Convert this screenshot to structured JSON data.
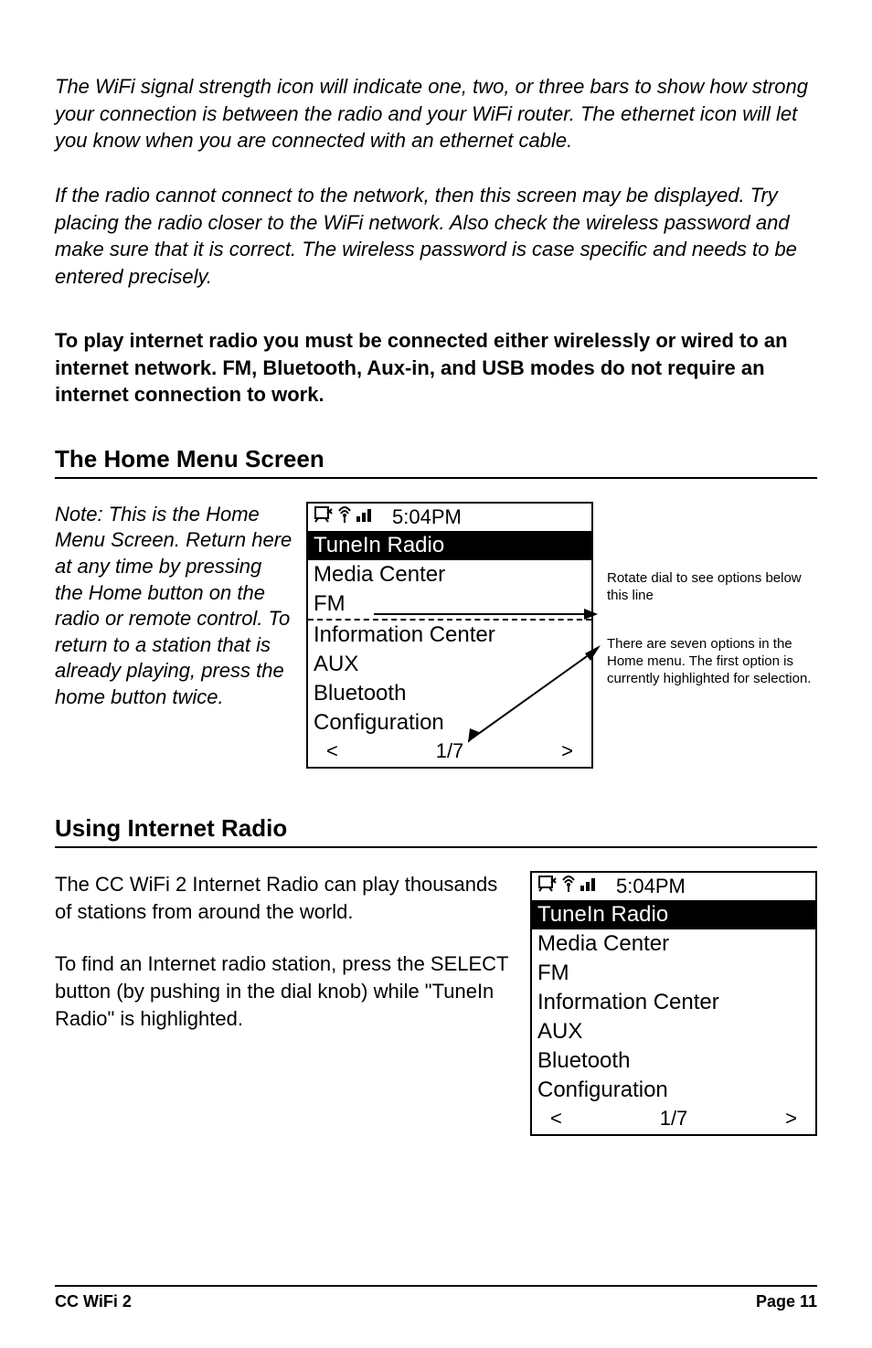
{
  "paragraphs": {
    "wifi_signal": "The WiFi signal strength icon will indicate one, two, or three bars to show how strong your connection is between the radio and your WiFi router. The ethernet icon will let you know when you are connected with an ethernet cable.",
    "cannot_connect": "If the radio cannot connect to the network, then this screen may be displayed. Try placing the radio closer to the WiFi network. Also check the wireless password and make sure that it is correct. The wireless password is case specific and needs to be entered precisely.",
    "to_play": "To play internet radio you must be connected either wirelessly or wired to an internet network. FM, Bluetooth, Aux-in, and USB modes do not require an internet connection to work."
  },
  "headings": {
    "home_menu": "The Home Menu Screen",
    "using_radio": "Using Internet Radio"
  },
  "home_note": "Note: This is the Home Menu Screen. Return here at any time by pressing the Home button on the radio or remote control. To return to a station that is already playing, press the home button twice.",
  "lcd1": {
    "time": "5:04PM",
    "highlight": "TuneIn Radio",
    "items": [
      "Media Center",
      "FM",
      "Information Center",
      "AUX",
      "Bluetooth",
      "Configuration"
    ],
    "footer_left": "<",
    "footer_center": "1/7",
    "footer_right": ">"
  },
  "callouts": {
    "rotate": "Rotate dial to see options below this line",
    "seven": "There are seven options in the Home menu. The first option is currently highlighted for selection."
  },
  "using": {
    "p1": "The CC WiFi 2 Internet Radio can play thousands of stations from around the world.",
    "p2": "To find an Internet radio station, press the SELECT button (by pushing in the dial knob) while \"TuneIn Radio\" is highlighted."
  },
  "lcd2": {
    "time": "5:04PM",
    "highlight": "TuneIn Radio",
    "items": [
      "Media Center",
      "FM",
      "Information Center",
      "AUX",
      "Bluetooth",
      "Configuration"
    ],
    "footer_left": "<",
    "footer_center": "1/7",
    "footer_right": ">"
  },
  "footer": {
    "left": "CC WiFi 2",
    "right": "Page 11"
  }
}
